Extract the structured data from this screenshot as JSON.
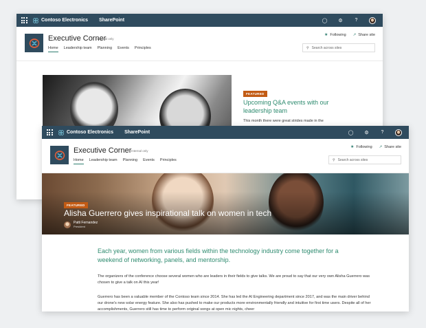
{
  "suite": {
    "brand": "Contoso Electronics",
    "app": "SharePoint"
  },
  "site": {
    "title": "Executive Corner",
    "badge": "Internal only",
    "nav": [
      "Home",
      "Leadership team",
      "Planning",
      "Events",
      "Principles"
    ],
    "follow_label": "Following",
    "share_label": "Share site",
    "search_placeholder": "Search across sites"
  },
  "back_article": {
    "tag": "FEATURED",
    "headline": "Upcoming Q&A events with our leadership team",
    "body_snippet": "This month there were great strides made in the"
  },
  "front_article": {
    "tag": "FEATURED",
    "title": "Alisha Guerrero gives inspirational talk on women in tech",
    "author_name": "Patti Fernandez",
    "author_role": "President",
    "lead": "Each year, women from various fields within the technology industry come together for a weekend of networking, panels, and mentorship.",
    "paragraph1": "The organizers of the conference choose several women who are leaders in their fields to give talks. We are proud to say that our very own Alisha Guerrero was chosen to give a talk on AI this year!",
    "paragraph2": "Guerrero has been a valuable member of the Contoso team since 2014. She has led the AI Engineering department since 2017, and was the main driver behind our drone's new solar energy feature. She also has pushed to make our products more environmentally friendly and intuitive for first time users. Despite all of her accomplishments, Guerrero still has time to perform original songs at open mic nights, cheer"
  },
  "colors": {
    "suitebar": "#2f4b5e",
    "accent": "#2e8b6f",
    "featured_tag": "#c25b14"
  }
}
